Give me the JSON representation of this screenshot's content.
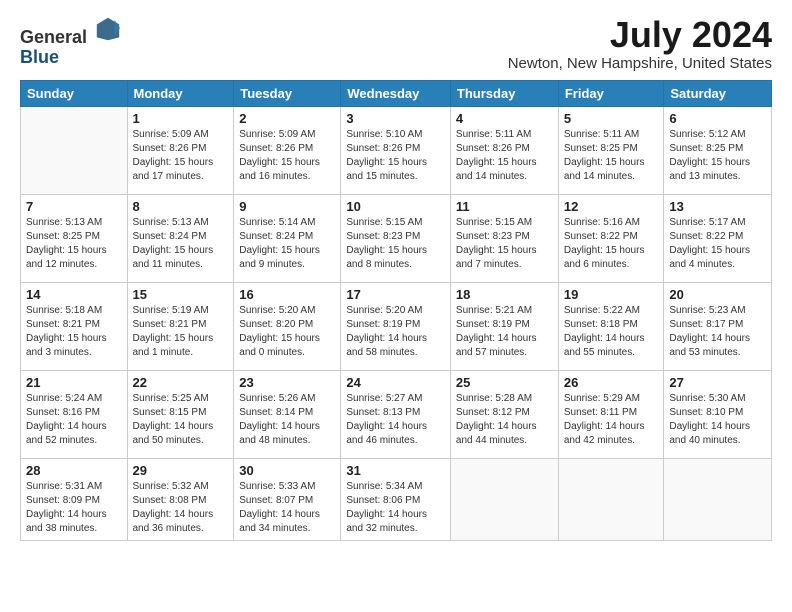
{
  "header": {
    "logo_general": "General",
    "logo_blue": "Blue",
    "month_title": "July 2024",
    "location": "Newton, New Hampshire, United States"
  },
  "days_of_week": [
    "Sunday",
    "Monday",
    "Tuesday",
    "Wednesday",
    "Thursday",
    "Friday",
    "Saturday"
  ],
  "weeks": [
    [
      {
        "day": "",
        "info": ""
      },
      {
        "day": "1",
        "info": "Sunrise: 5:09 AM\nSunset: 8:26 PM\nDaylight: 15 hours\nand 17 minutes."
      },
      {
        "day": "2",
        "info": "Sunrise: 5:09 AM\nSunset: 8:26 PM\nDaylight: 15 hours\nand 16 minutes."
      },
      {
        "day": "3",
        "info": "Sunrise: 5:10 AM\nSunset: 8:26 PM\nDaylight: 15 hours\nand 15 minutes."
      },
      {
        "day": "4",
        "info": "Sunrise: 5:11 AM\nSunset: 8:26 PM\nDaylight: 15 hours\nand 14 minutes."
      },
      {
        "day": "5",
        "info": "Sunrise: 5:11 AM\nSunset: 8:25 PM\nDaylight: 15 hours\nand 14 minutes."
      },
      {
        "day": "6",
        "info": "Sunrise: 5:12 AM\nSunset: 8:25 PM\nDaylight: 15 hours\nand 13 minutes."
      }
    ],
    [
      {
        "day": "7",
        "info": "Sunrise: 5:13 AM\nSunset: 8:25 PM\nDaylight: 15 hours\nand 12 minutes."
      },
      {
        "day": "8",
        "info": "Sunrise: 5:13 AM\nSunset: 8:24 PM\nDaylight: 15 hours\nand 11 minutes."
      },
      {
        "day": "9",
        "info": "Sunrise: 5:14 AM\nSunset: 8:24 PM\nDaylight: 15 hours\nand 9 minutes."
      },
      {
        "day": "10",
        "info": "Sunrise: 5:15 AM\nSunset: 8:23 PM\nDaylight: 15 hours\nand 8 minutes."
      },
      {
        "day": "11",
        "info": "Sunrise: 5:15 AM\nSunset: 8:23 PM\nDaylight: 15 hours\nand 7 minutes."
      },
      {
        "day": "12",
        "info": "Sunrise: 5:16 AM\nSunset: 8:22 PM\nDaylight: 15 hours\nand 6 minutes."
      },
      {
        "day": "13",
        "info": "Sunrise: 5:17 AM\nSunset: 8:22 PM\nDaylight: 15 hours\nand 4 minutes."
      }
    ],
    [
      {
        "day": "14",
        "info": "Sunrise: 5:18 AM\nSunset: 8:21 PM\nDaylight: 15 hours\nand 3 minutes."
      },
      {
        "day": "15",
        "info": "Sunrise: 5:19 AM\nSunset: 8:21 PM\nDaylight: 15 hours\nand 1 minute."
      },
      {
        "day": "16",
        "info": "Sunrise: 5:20 AM\nSunset: 8:20 PM\nDaylight: 15 hours\nand 0 minutes."
      },
      {
        "day": "17",
        "info": "Sunrise: 5:20 AM\nSunset: 8:19 PM\nDaylight: 14 hours\nand 58 minutes."
      },
      {
        "day": "18",
        "info": "Sunrise: 5:21 AM\nSunset: 8:19 PM\nDaylight: 14 hours\nand 57 minutes."
      },
      {
        "day": "19",
        "info": "Sunrise: 5:22 AM\nSunset: 8:18 PM\nDaylight: 14 hours\nand 55 minutes."
      },
      {
        "day": "20",
        "info": "Sunrise: 5:23 AM\nSunset: 8:17 PM\nDaylight: 14 hours\nand 53 minutes."
      }
    ],
    [
      {
        "day": "21",
        "info": "Sunrise: 5:24 AM\nSunset: 8:16 PM\nDaylight: 14 hours\nand 52 minutes."
      },
      {
        "day": "22",
        "info": "Sunrise: 5:25 AM\nSunset: 8:15 PM\nDaylight: 14 hours\nand 50 minutes."
      },
      {
        "day": "23",
        "info": "Sunrise: 5:26 AM\nSunset: 8:14 PM\nDaylight: 14 hours\nand 48 minutes."
      },
      {
        "day": "24",
        "info": "Sunrise: 5:27 AM\nSunset: 8:13 PM\nDaylight: 14 hours\nand 46 minutes."
      },
      {
        "day": "25",
        "info": "Sunrise: 5:28 AM\nSunset: 8:12 PM\nDaylight: 14 hours\nand 44 minutes."
      },
      {
        "day": "26",
        "info": "Sunrise: 5:29 AM\nSunset: 8:11 PM\nDaylight: 14 hours\nand 42 minutes."
      },
      {
        "day": "27",
        "info": "Sunrise: 5:30 AM\nSunset: 8:10 PM\nDaylight: 14 hours\nand 40 minutes."
      }
    ],
    [
      {
        "day": "28",
        "info": "Sunrise: 5:31 AM\nSunset: 8:09 PM\nDaylight: 14 hours\nand 38 minutes."
      },
      {
        "day": "29",
        "info": "Sunrise: 5:32 AM\nSunset: 8:08 PM\nDaylight: 14 hours\nand 36 minutes."
      },
      {
        "day": "30",
        "info": "Sunrise: 5:33 AM\nSunset: 8:07 PM\nDaylight: 14 hours\nand 34 minutes."
      },
      {
        "day": "31",
        "info": "Sunrise: 5:34 AM\nSunset: 8:06 PM\nDaylight: 14 hours\nand 32 minutes."
      },
      {
        "day": "",
        "info": ""
      },
      {
        "day": "",
        "info": ""
      },
      {
        "day": "",
        "info": ""
      }
    ]
  ]
}
